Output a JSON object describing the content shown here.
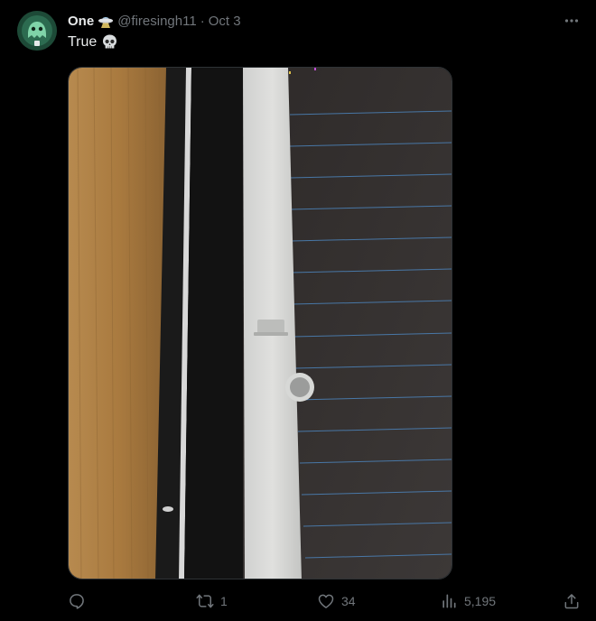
{
  "author": {
    "display_name": "One",
    "handle": "@firesingh11",
    "separator": "·",
    "date": "Oct 3",
    "badge_icon": "ufo-emoji",
    "avatar_icon": "green-ghost-avatar"
  },
  "tweet": {
    "text": "True",
    "emoji": "skull-emoji"
  },
  "media": {
    "description_icon": "photo-ipad-pencil-on-desk"
  },
  "actions": {
    "reply_count": "",
    "retweet_count": "1",
    "like_count": "34",
    "views_count": "5,195"
  },
  "colors": {
    "background": "#000000",
    "text_primary": "#e7e9ea",
    "text_secondary": "#71767b",
    "border": "#2f3336"
  }
}
